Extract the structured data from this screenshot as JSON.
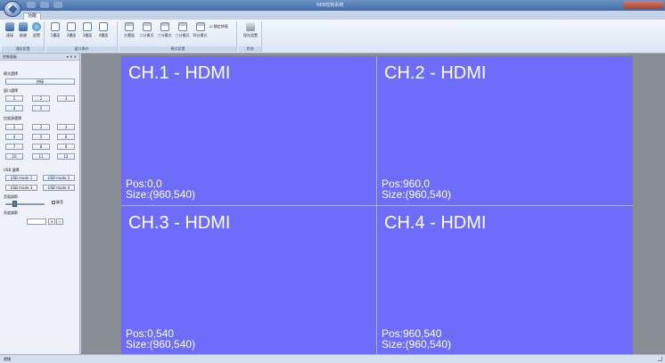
{
  "app": {
    "title": "NEB控制系統",
    "ribbon_tab": "功能"
  },
  "ribbon": {
    "groups": [
      {
        "label": "通訊設置",
        "buttons": [
          "連接",
          "斷開",
          "設置"
        ]
      },
      {
        "label": "窗口操作",
        "buttons": [
          "1畫面",
          "2畫面",
          "3畫面",
          "4畫面"
        ]
      },
      {
        "label": "模式設置",
        "buttons": [
          "大畫面",
          "二分模式",
          "三分模式",
          "三分模式",
          "四分模式"
        ],
        "checkbox": "鎖定拼接"
      },
      {
        "label": "其他",
        "buttons": [
          "保存設置"
        ]
      }
    ]
  },
  "left_panel": {
    "header": "控制面板",
    "header_controls": "▾ ✕ ✕",
    "section_window_mode": "模式選擇",
    "mode_button": "拼接",
    "section_screen_count": "窗口選擇",
    "screen_buttons": [
      "1",
      "2",
      "3",
      "4",
      "5",
      "6"
    ],
    "section_signal": "信號源選擇",
    "signal_buttons": [
      "1",
      "2",
      "3",
      "4",
      "5",
      "6",
      "7",
      "8",
      "9",
      "10",
      "11",
      "12",
      "13",
      "14",
      "15",
      "16"
    ],
    "section_usb": "USB 選擇",
    "usb_buttons": [
      "USB mode 1",
      "USB mode 2",
      "USB mode 3",
      "USB mode 4"
    ],
    "section_volume": "音量調節",
    "mute_label": "靜音",
    "section_brightness": "亮度調節",
    "spin_plus": "+",
    "spin_minus": "−"
  },
  "channels": [
    {
      "title": "CH.1 - HDMI",
      "pos": "Pos:0,0",
      "size": "Size:(960,540)"
    },
    {
      "title": "CH.2 - HDMI",
      "pos": "Pos:960,0",
      "size": "Size:(960,540)"
    },
    {
      "title": "CH.3 - HDMI",
      "pos": "Pos:0,540",
      "size": "Size:(960,540)"
    },
    {
      "title": "CH.4 - HDMI",
      "pos": "Pos:960,540",
      "size": "Size:(960,540)"
    }
  ],
  "volume_level": 0.2,
  "status": {
    "text": "就緒"
  },
  "colors": {
    "canvas": "#6d6dfa",
    "stage": "#898d94",
    "divider": "#a9a9ff"
  }
}
